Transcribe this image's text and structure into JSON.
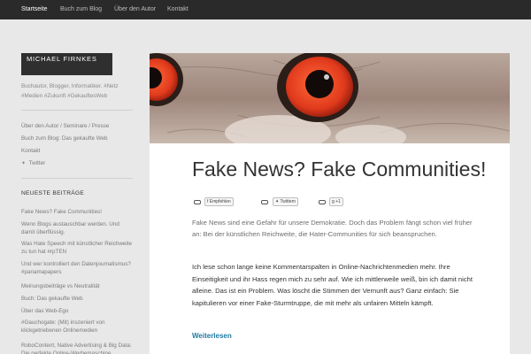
{
  "nav": {
    "items": [
      "Startseite",
      "Buch zum Blog",
      "Über den Autor",
      "Kontakt"
    ]
  },
  "sidebar": {
    "title": "Michael Firnkes",
    "tagline": "Buchautor, Blogger, Informatiker. #Netz #Medien #Zukunft #GekauftesWeb",
    "links": [
      "Über den Autor / Seminare / Presse",
      "Buch zum Blog: Das gekaufte Web",
      "Kontakt",
      "Twitter"
    ],
    "recent_heading": "NEUESTE BEITRÄGE",
    "recent_posts": [
      "Fake News? Fake Communities!",
      "Wenn Blogs austauschbar werden. Und damit überflüssig.",
      "Was Hate Speech mit künstlicher Reichweite zu tun hat #rpTEN",
      "Und wer kontrolliert den Datenjournalismus? #panamapapers",
      "Meinungsbeiträge vs Neutralität",
      "Buch: Das gekaufte Web",
      "Über das Web-Ego",
      "#Gauchogate: (Mit) inszeniert von klickgetriebenen Onlinemedien",
      "RoboContent, Native Advertising & Big Data: Die perfekte Online-Werbemaschine"
    ]
  },
  "post": {
    "title": "Fake News? Fake Communities!",
    "share": {
      "facebook": "Empfehlen",
      "twitter": "Twittern",
      "gplus": "+1"
    },
    "lead": "Fake News sind eine Gefahr für unsere Demokratie. Doch das Problem fängt schon viel früher an: Bei der künstlichen Reichweite, die Hater-Communities für sich beanspruchen.",
    "body": "Ich lese schon lange keine Kommentarspalten in Online-Nachrichtenmedien mehr. Ihre Einseitigkeit und ihr Hass regen mich zu sehr auf. Wie ich mittlerweile weiß, bin ich damit nicht alleine. Das ist ein Problem. Was löscht die Stimmen der Vernunft aus? Ganz einfach: Sie kapitulieren vor einer Fake-Sturmtruppe, die mit mehr als unfairen Mitteln kämpft.",
    "read_more": "Weiterlesen"
  },
  "colors": {
    "topbar": "#2a2a2a",
    "background": "#e8e8e8",
    "link": "#1f7aa3",
    "owl_eye": "#e03a1c"
  }
}
